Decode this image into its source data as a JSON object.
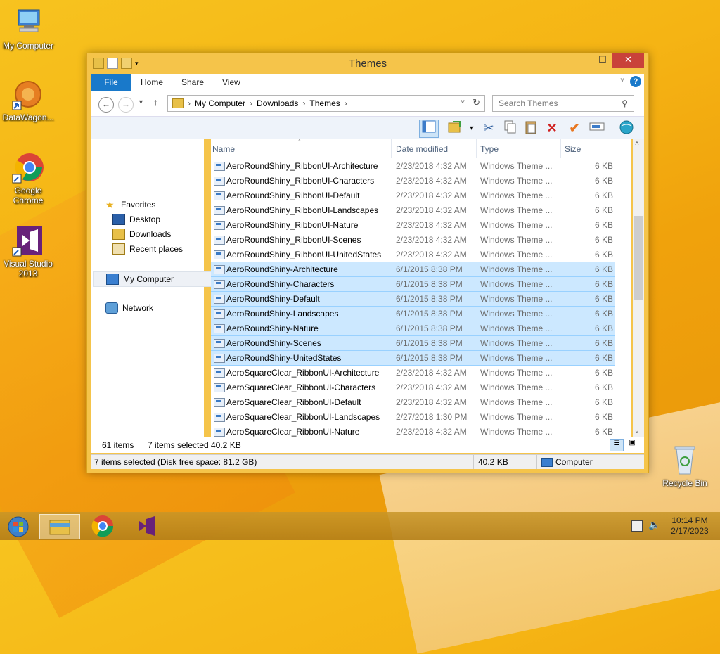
{
  "desktop": {
    "icons": [
      {
        "label": "My Computer",
        "icon": "my-computer-icon"
      },
      {
        "label": "DataWagon...",
        "icon": "datawagon-icon"
      },
      {
        "label": "Google Chrome",
        "icon": "chrome-icon"
      },
      {
        "label": "Visual Studio 2013",
        "icon": "visual-studio-icon"
      },
      {
        "label": "Recycle Bin",
        "icon": "recycle-bin-icon"
      }
    ]
  },
  "window": {
    "title": "Themes",
    "ribbon_tabs": [
      "File",
      "Home",
      "Share",
      "View"
    ],
    "breadcrumb": [
      "My Computer",
      "Downloads",
      "Themes"
    ],
    "search_placeholder": "Search Themes",
    "nav": {
      "favorites": "Favorites",
      "items": [
        "Desktop",
        "Downloads",
        "Recent places"
      ],
      "computer": "My Computer",
      "network": "Network"
    },
    "columns": [
      "Name",
      "Date modified",
      "Type",
      "Size"
    ],
    "files": [
      {
        "name": "AeroRoundShiny_RibbonUI-Architecture",
        "date": "2/23/2018 4:32 AM",
        "type": "Windows Theme ...",
        "size": "6 KB",
        "selected": false
      },
      {
        "name": "AeroRoundShiny_RibbonUI-Characters",
        "date": "2/23/2018 4:32 AM",
        "type": "Windows Theme ...",
        "size": "6 KB",
        "selected": false
      },
      {
        "name": "AeroRoundShiny_RibbonUI-Default",
        "date": "2/23/2018 4:32 AM",
        "type": "Windows Theme ...",
        "size": "6 KB",
        "selected": false
      },
      {
        "name": "AeroRoundShiny_RibbonUI-Landscapes",
        "date": "2/23/2018 4:32 AM",
        "type": "Windows Theme ...",
        "size": "6 KB",
        "selected": false
      },
      {
        "name": "AeroRoundShiny_RibbonUI-Nature",
        "date": "2/23/2018 4:32 AM",
        "type": "Windows Theme ...",
        "size": "6 KB",
        "selected": false
      },
      {
        "name": "AeroRoundShiny_RibbonUI-Scenes",
        "date": "2/23/2018 4:32 AM",
        "type": "Windows Theme ...",
        "size": "6 KB",
        "selected": false
      },
      {
        "name": "AeroRoundShiny_RibbonUI-UnitedStates",
        "date": "2/23/2018 4:32 AM",
        "type": "Windows Theme ...",
        "size": "6 KB",
        "selected": false
      },
      {
        "name": "AeroRoundShiny-Architecture",
        "date": "6/1/2015 8:38 PM",
        "type": "Windows Theme ...",
        "size": "6 KB",
        "selected": true
      },
      {
        "name": "AeroRoundShiny-Characters",
        "date": "6/1/2015 8:38 PM",
        "type": "Windows Theme ...",
        "size": "6 KB",
        "selected": true
      },
      {
        "name": "AeroRoundShiny-Default",
        "date": "6/1/2015 8:38 PM",
        "type": "Windows Theme ...",
        "size": "6 KB",
        "selected": true
      },
      {
        "name": "AeroRoundShiny-Landscapes",
        "date": "6/1/2015 8:38 PM",
        "type": "Windows Theme ...",
        "size": "6 KB",
        "selected": true
      },
      {
        "name": "AeroRoundShiny-Nature",
        "date": "6/1/2015 8:38 PM",
        "type": "Windows Theme ...",
        "size": "6 KB",
        "selected": true
      },
      {
        "name": "AeroRoundShiny-Scenes",
        "date": "6/1/2015 8:38 PM",
        "type": "Windows Theme ...",
        "size": "6 KB",
        "selected": true
      },
      {
        "name": "AeroRoundShiny-UnitedStates",
        "date": "6/1/2015 8:38 PM",
        "type": "Windows Theme ...",
        "size": "6 KB",
        "selected": true
      },
      {
        "name": "AeroSquareClear_RibbonUI-Architecture",
        "date": "2/23/2018 4:32 AM",
        "type": "Windows Theme ...",
        "size": "6 KB",
        "selected": false
      },
      {
        "name": "AeroSquareClear_RibbonUI-Characters",
        "date": "2/23/2018 4:32 AM",
        "type": "Windows Theme ...",
        "size": "6 KB",
        "selected": false
      },
      {
        "name": "AeroSquareClear_RibbonUI-Default",
        "date": "2/23/2018 4:32 AM",
        "type": "Windows Theme ...",
        "size": "6 KB",
        "selected": false
      },
      {
        "name": "AeroSquareClear_RibbonUI-Landscapes",
        "date": "2/27/2018 1:30 PM",
        "type": "Windows Theme ...",
        "size": "6 KB",
        "selected": false
      },
      {
        "name": "AeroSquareClear_RibbonUI-Nature",
        "date": "2/23/2018 4:32 AM",
        "type": "Windows Theme ...",
        "size": "6 KB",
        "selected": false
      }
    ],
    "status": {
      "item_count": "61 items",
      "selected_count": "7 items selected",
      "selected_size": "40.2 KB",
      "details": "7 items selected (Disk free space: 81.2 GB)",
      "details_size": "40.2 KB",
      "location": "Computer"
    }
  },
  "taskbar": {
    "time": "10:14 PM",
    "date": "2/17/2023"
  },
  "colors": {
    "accent": "#1979ca",
    "selection": "#cce8ff",
    "close": "#c9423a"
  }
}
